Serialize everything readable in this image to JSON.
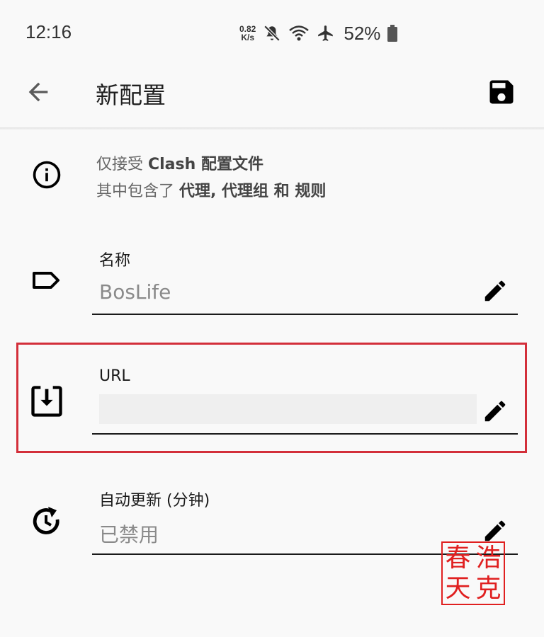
{
  "status_bar": {
    "time": "12:16",
    "net_speed_value": "0.82",
    "net_speed_unit": "K/s",
    "battery": "52%",
    "icons": [
      "mute-icon",
      "wifi-icon",
      "airplane-icon",
      "battery-icon"
    ]
  },
  "app_bar": {
    "title": "新配置",
    "back_icon": "arrow-back-icon",
    "save_icon": "save-icon"
  },
  "info": {
    "icon": "info-icon",
    "line1_prefix": "仅接受 ",
    "line1_bold": "Clash 配置文件",
    "line2_prefix": "其中包含了 ",
    "line2_bold": "代理, 代理组 和 规则"
  },
  "fields": {
    "name": {
      "label": "名称",
      "value": "BosLife",
      "icon": "label-tag-icon"
    },
    "url": {
      "label": "URL",
      "value": "",
      "icon": "download-box-icon"
    },
    "auto_update": {
      "label": "自动更新 (分钟)",
      "value": "已禁用",
      "icon": "clock-refresh-icon"
    }
  },
  "stamp": {
    "chars": [
      "春",
      "浩",
      "天",
      "克"
    ]
  },
  "colors": {
    "highlight": "#d32f3a",
    "stamp": "#e02020"
  }
}
